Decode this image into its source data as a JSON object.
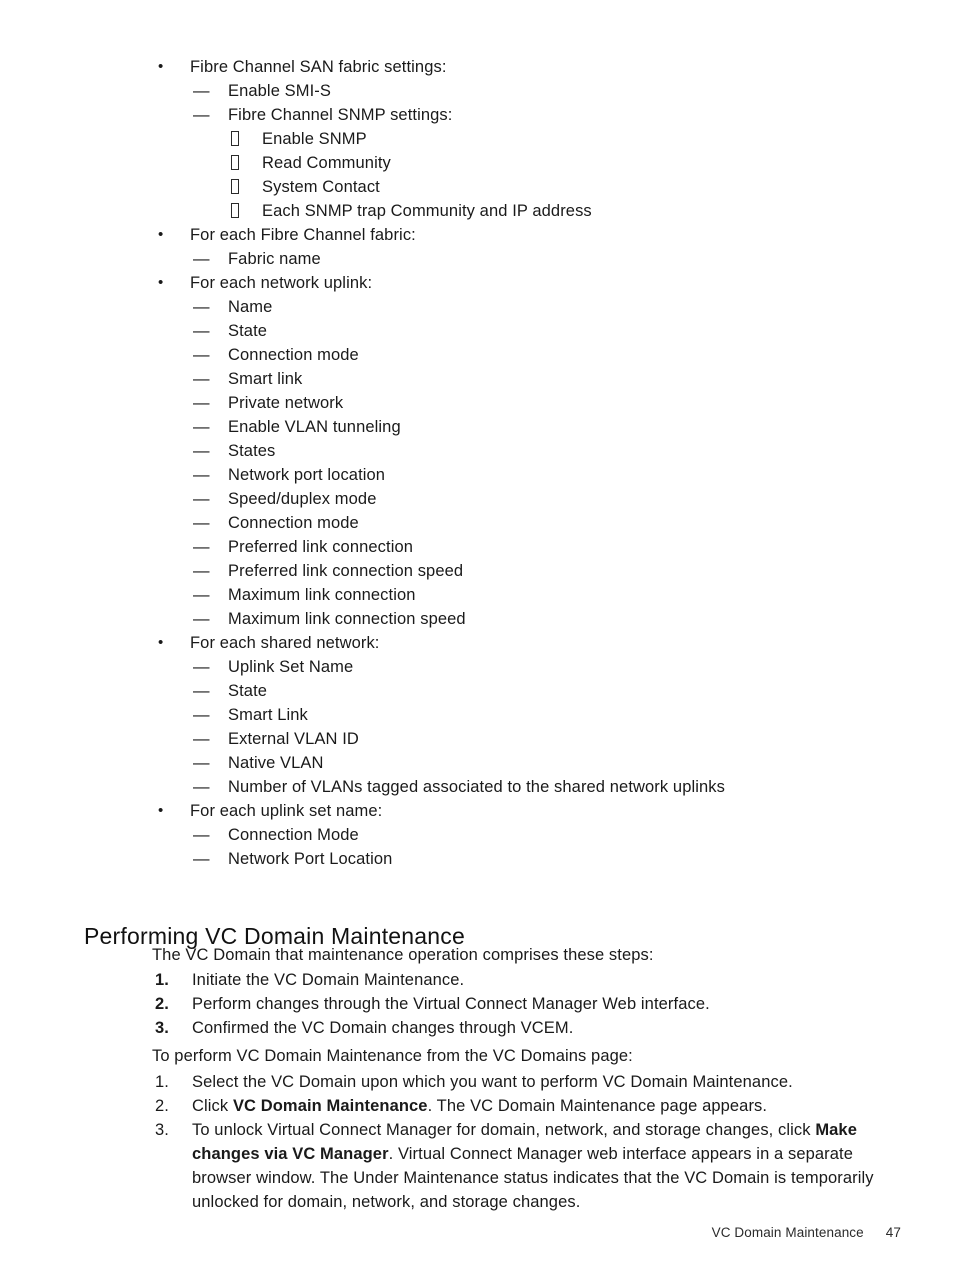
{
  "page": {
    "footer_label": "VC Domain Maintenance",
    "footer_page_number": "47",
    "bullet_glyph": "•",
    "dash_glyph": "—"
  },
  "bullets": [
    {
      "level": 1,
      "text": "Fibre Channel SAN fabric settings:"
    },
    {
      "level": 2,
      "text": "Enable SMI-S"
    },
    {
      "level": 2,
      "text": "Fibre Channel SNMP settings:"
    },
    {
      "level": 3,
      "text": "Enable SNMP"
    },
    {
      "level": 3,
      "text": "Read Community"
    },
    {
      "level": 3,
      "text": "System Contact"
    },
    {
      "level": 3,
      "text": "Each SNMP trap Community and IP address"
    },
    {
      "level": 1,
      "text": "For each Fibre Channel fabric:"
    },
    {
      "level": 2,
      "text": "Fabric name"
    },
    {
      "level": 1,
      "text": "For each network uplink:"
    },
    {
      "level": 2,
      "text": "Name"
    },
    {
      "level": 2,
      "text": "State"
    },
    {
      "level": 2,
      "text": "Connection mode"
    },
    {
      "level": 2,
      "text": "Smart link"
    },
    {
      "level": 2,
      "text": "Private network"
    },
    {
      "level": 2,
      "text": "Enable VLAN tunneling"
    },
    {
      "level": 2,
      "text": "States"
    },
    {
      "level": 2,
      "text": "Network port location"
    },
    {
      "level": 2,
      "text": "Speed/duplex mode"
    },
    {
      "level": 2,
      "text": "Connection mode"
    },
    {
      "level": 2,
      "text": "Preferred link connection"
    },
    {
      "level": 2,
      "text": "Preferred link connection speed"
    },
    {
      "level": 2,
      "text": "Maximum link connection"
    },
    {
      "level": 2,
      "text": "Maximum link connection speed"
    },
    {
      "level": 1,
      "text": "For each shared network:"
    },
    {
      "level": 2,
      "text": "Uplink Set Name"
    },
    {
      "level": 2,
      "text": "State"
    },
    {
      "level": 2,
      "text": "Smart Link"
    },
    {
      "level": 2,
      "text": "External VLAN ID"
    },
    {
      "level": 2,
      "text": "Native VLAN"
    },
    {
      "level": 2,
      "text": "Number of VLANs tagged associated to the shared network uplinks"
    },
    {
      "level": 1,
      "text": "For each uplink set name:"
    },
    {
      "level": 2,
      "text": "Connection Mode"
    },
    {
      "level": 2,
      "text": "Network Port Location"
    }
  ],
  "section": {
    "heading": "Performing VC Domain Maintenance",
    "intro_paragraph": "The VC Domain that maintenance operation comprises these steps:",
    "steps_overview": [
      {
        "num": "1.",
        "text": "Initiate the VC Domain Maintenance."
      },
      {
        "num": "2.",
        "text": "Perform changes through the Virtual Connect Manager Web interface."
      },
      {
        "num": "3.",
        "text": "Confirmed the VC Domain changes through VCEM."
      }
    ],
    "procedure_lead_in": "To perform VC Domain Maintenance from the VC Domains page:",
    "procedure_steps": [
      {
        "num": "1.",
        "parts": [
          {
            "bold": false,
            "text": "Select the VC Domain upon which you want to perform VC Domain Maintenance."
          }
        ]
      },
      {
        "num": "2.",
        "parts": [
          {
            "bold": false,
            "text": "Click "
          },
          {
            "bold": true,
            "text": "VC Domain Maintenance"
          },
          {
            "bold": false,
            "text": ". The VC Domain Maintenance page appears."
          }
        ]
      },
      {
        "num": "3.",
        "parts": [
          {
            "bold": false,
            "text": "To unlock Virtual Connect Manager for domain, network, and storage changes, click "
          },
          {
            "bold": true,
            "text": "Make changes via VC Manager"
          },
          {
            "bold": false,
            "text": ". Virtual Connect Manager web interface appears in a separate browser window. The Under Maintenance status indicates that the VC Domain is temporarily unlocked for domain, network, and storage changes."
          }
        ]
      }
    ]
  }
}
